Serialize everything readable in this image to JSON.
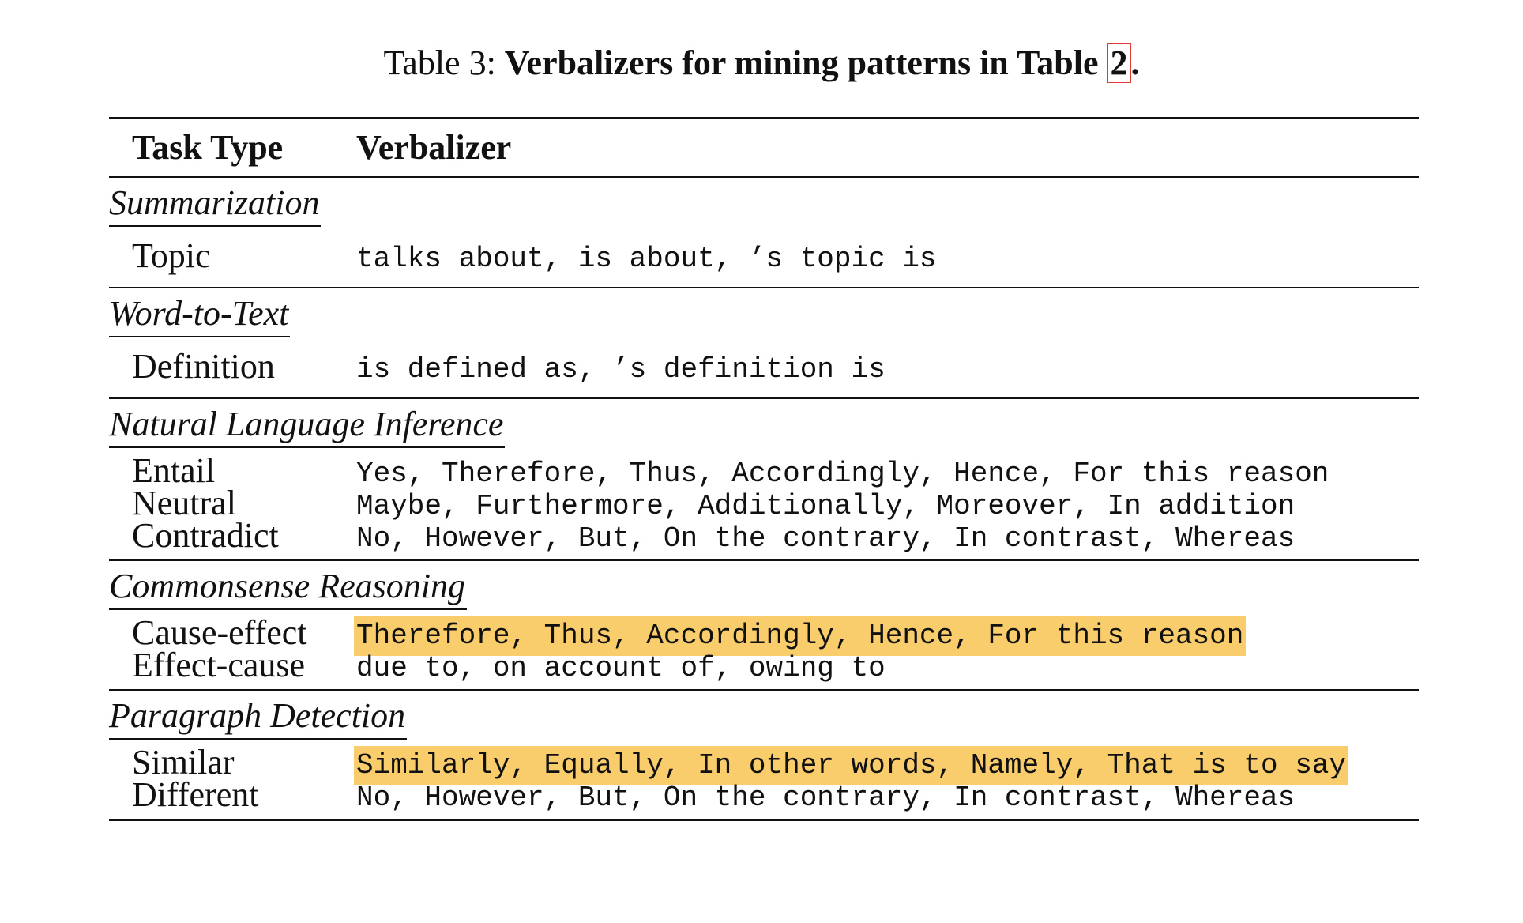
{
  "caption": {
    "label": "Table 3:",
    "title": "Verbalizers for mining patterns in Table",
    "ref": "2",
    "period": "."
  },
  "headers": {
    "task_type": "Task Type",
    "verbalizer": "Verbalizer"
  },
  "highlight_color": "#f9cd6c",
  "sections": [
    {
      "title": "Summarization",
      "rows": [
        {
          "type": "Topic",
          "verbalizer": "talks about, is about, ’s topic is",
          "highlighted": false
        }
      ]
    },
    {
      "title": "Word-to-Text",
      "rows": [
        {
          "type": "Definition",
          "verbalizer": "is defined as, ’s definition is",
          "highlighted": false
        }
      ]
    },
    {
      "title": "Natural Language Inference",
      "rows": [
        {
          "type": "Entail",
          "verbalizer": "Yes, Therefore, Thus, Accordingly, Hence, For this reason",
          "highlighted": false
        },
        {
          "type": "Neutral",
          "verbalizer": "Maybe, Furthermore, Additionally, Moreover, In addition",
          "highlighted": false
        },
        {
          "type": "Contradict",
          "verbalizer": "No, However, But, On the contrary, In contrast, Whereas",
          "highlighted": false
        }
      ]
    },
    {
      "title": "Commonsense Reasoning",
      "rows": [
        {
          "type": "Cause-effect",
          "verbalizer": "Therefore, Thus, Accordingly, Hence, For this reason",
          "highlighted": true
        },
        {
          "type": "Effect-cause",
          "verbalizer": "due to, on account of, owing to",
          "highlighted": false
        }
      ]
    },
    {
      "title": "Paragraph Detection",
      "rows": [
        {
          "type": "Similar",
          "verbalizer": "Similarly, Equally, In other words, Namely, That is to say",
          "highlighted": true
        },
        {
          "type": "Different",
          "verbalizer": "No, However, But, On the contrary, In contrast, Whereas",
          "highlighted": false
        }
      ]
    }
  ]
}
